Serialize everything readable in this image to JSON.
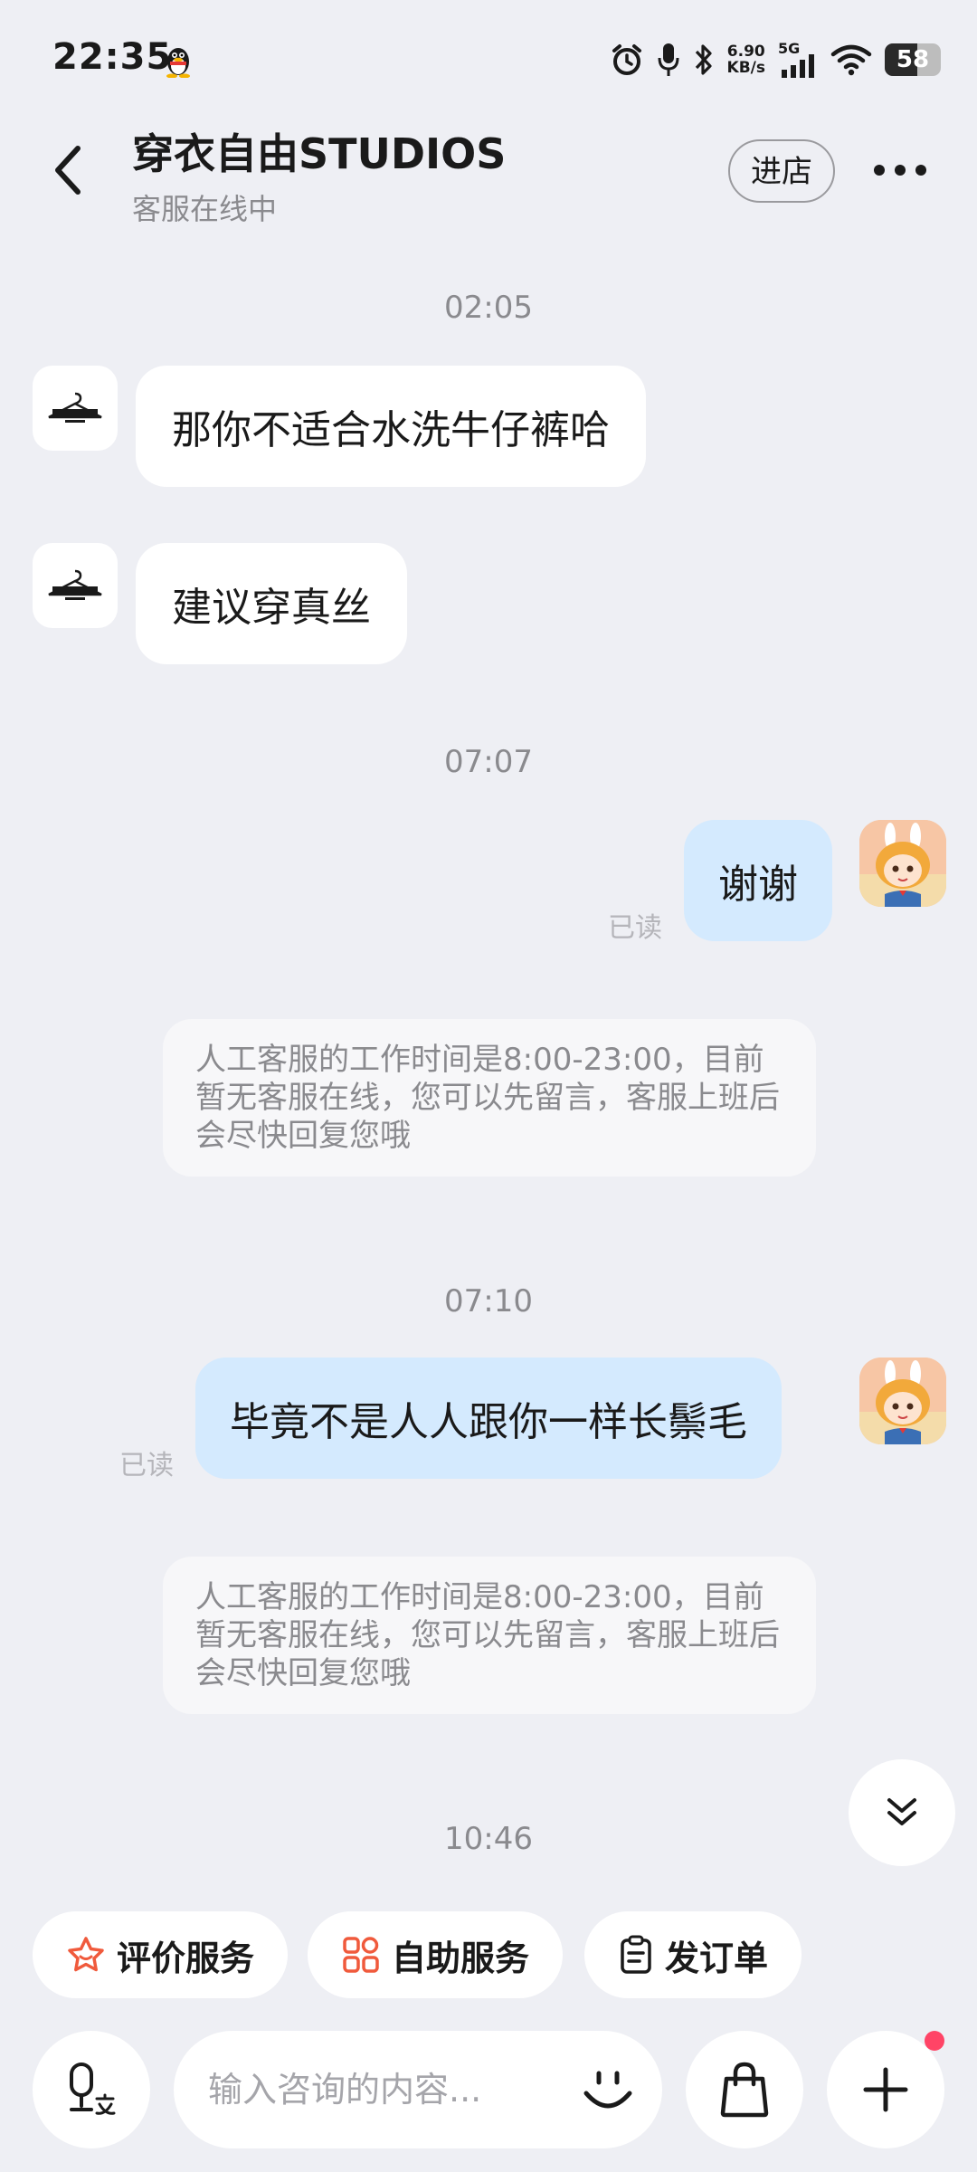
{
  "status_bar": {
    "time": "22:35",
    "net_speed_value": "6.90",
    "net_speed_unit": "KB/s",
    "network_type": "5G",
    "battery": "58"
  },
  "header": {
    "title": "穿衣自由STUDIOS",
    "subtitle": "客服在线中",
    "store_button": "进店"
  },
  "messages": {
    "ts1": "02:05",
    "m1": "那你不适合水洗牛仔裤哈",
    "m2": "建议穿真丝",
    "ts2": "07:07",
    "m3": "谢谢",
    "m3_read": "已读",
    "sys1": "人工客服的工作时间是8:00-23:00，目前暂无客服在线，您可以先留言，客服上班后会尽快回复您哦",
    "ts3": "07:10",
    "m4": "毕竟不是人人跟你一样长鬃毛",
    "m4_read": "已读",
    "sys2": "人工客服的工作时间是8:00-23:00，目前暂无客服在线，您可以先留言，客服上班后会尽快回复您哦",
    "ts4": "10:46"
  },
  "quick_actions": {
    "rate": "评价服务",
    "self_service": "自助服务",
    "invoice": "发订单"
  },
  "input": {
    "placeholder": "输入咨询的内容..."
  },
  "colors": {
    "background": "#eeeff4",
    "outgoing_bubble": "#d4eafe",
    "notification_dot": "#ff4466",
    "rate_icon": "#f05a3c",
    "self_service_icon": "#f05a3c"
  }
}
